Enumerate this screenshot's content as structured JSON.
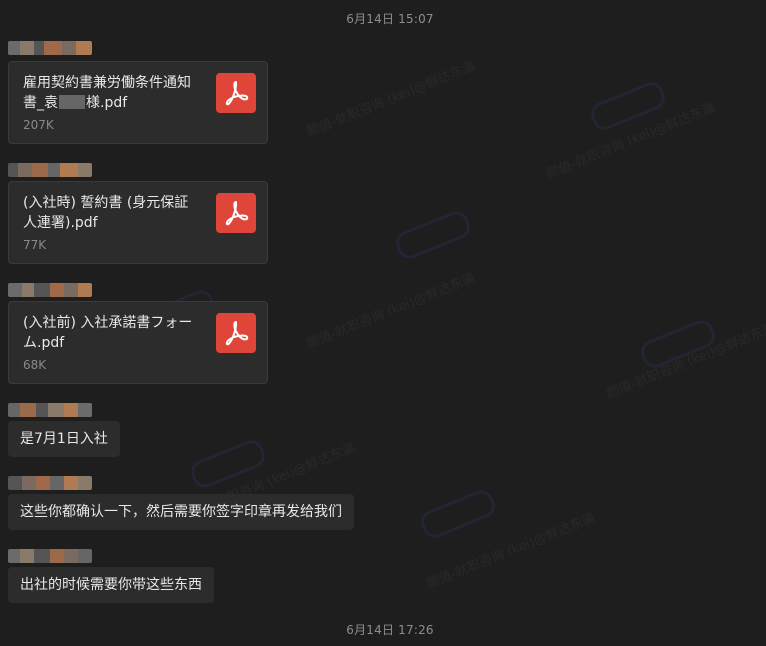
{
  "timestamps": [
    "6月14日 15:07",
    "6月14日 17:26"
  ],
  "files": [
    {
      "name_line1": "雇用契約書兼労働条件通知",
      "name_line2": "書_袁",
      "name_line2_end": "様.pdf",
      "size": "207K",
      "icon": "pdf-icon"
    },
    {
      "name_line1": "(入社時) 誓約書 (身元保証",
      "name_line2": "人連署).pdf",
      "name_line2_end": "",
      "size": "77K",
      "icon": "pdf-icon"
    },
    {
      "name_line1": "(入社前) 入社承諾書フォー",
      "name_line2": "ム.pdf",
      "name_line2_end": "",
      "size": "68K",
      "icon": "pdf-icon"
    }
  ],
  "messages": [
    "是7月1日入社",
    "这些你都确认一下，然后需要你签字印章再发给我们",
    "出社的时候需要你带这些东西"
  ],
  "watermark": "颜值-就职咨询 (kei)@鲜达东瀛",
  "colors": {
    "background": "#1e1e1e",
    "bubble": "#2c2c2c",
    "pdf_red": "#e0453a"
  }
}
